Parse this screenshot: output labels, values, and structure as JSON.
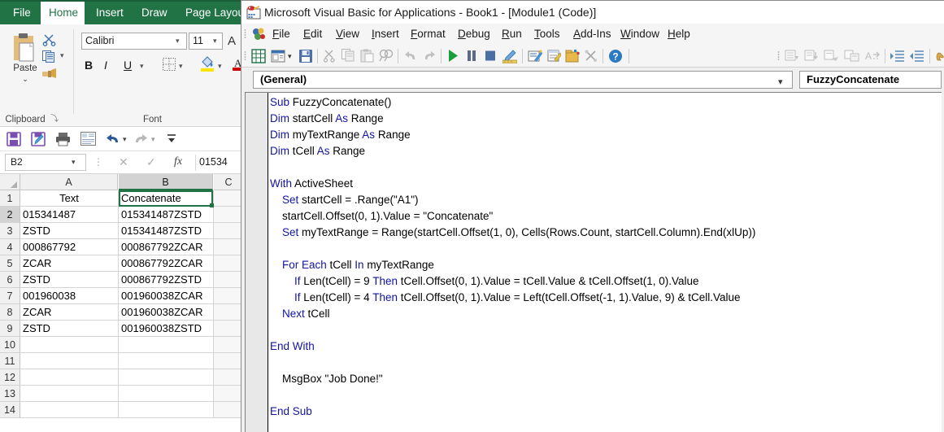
{
  "excel": {
    "ribbon_tabs": [
      {
        "label": "File",
        "active": false
      },
      {
        "label": "Home",
        "active": true
      },
      {
        "label": "Insert",
        "active": false
      },
      {
        "label": "Draw",
        "active": false
      },
      {
        "label": "Page Layout",
        "active": false
      }
    ],
    "groups": {
      "clipboard": {
        "label": "Clipboard",
        "paste_label": "Paste",
        "paste_caret": "⌄",
        "cut_icon": "scissors-icon",
        "copy_icon": "copy-icon",
        "format_painter_icon": "paintbrush-icon",
        "dialog_launcher": "⤵"
      },
      "font": {
        "label": "Font",
        "font_name": "Calibri",
        "font_size": "11",
        "bold_label": "B",
        "italic_label": "I",
        "underline_label": "U",
        "grow_font_label": "A",
        "borders_icon": "borders-icon",
        "fill_color_icon": "fill-color-icon",
        "font_color_icon": "font-color-icon"
      }
    },
    "quick_access": [
      {
        "icon": "save-icon",
        "name": "save"
      },
      {
        "icon": "save-as-icon",
        "name": "save-as"
      },
      {
        "icon": "print-icon",
        "name": "print"
      },
      {
        "icon": "print-preview-icon",
        "name": "print-preview"
      },
      {
        "icon": "undo-icon",
        "name": "undo"
      },
      {
        "icon": "redo-icon",
        "name": "redo"
      },
      {
        "icon": "customize-icon",
        "name": "customize"
      }
    ],
    "formula_bar": {
      "name_box": "B2",
      "cancel_label": "✕",
      "enter_label": "✓",
      "fx_label": "fx",
      "value": "01534"
    },
    "grid": {
      "columns": [
        {
          "label": "A",
          "selected": false
        },
        {
          "label": "B",
          "selected": true
        },
        {
          "label": "C",
          "selected": false
        }
      ],
      "selected_cell": "B2",
      "rows": [
        {
          "num": "1",
          "a": "Text",
          "b": "Concatenate",
          "a_center": true
        },
        {
          "num": "2",
          "a": "015341487",
          "b": "015341487ZSTD",
          "a_center": false
        },
        {
          "num": "3",
          "a": "ZSTD",
          "b": "015341487ZSTD",
          "a_center": false
        },
        {
          "num": "4",
          "a": "000867792",
          "b": "000867792ZCAR",
          "a_center": false
        },
        {
          "num": "5",
          "a": "ZCAR",
          "b": "000867792ZCAR",
          "a_center": false
        },
        {
          "num": "6",
          "a": "ZSTD",
          "b": "000867792ZSTD",
          "a_center": false
        },
        {
          "num": "7",
          "a": "001960038",
          "b": "001960038ZCAR",
          "a_center": false
        },
        {
          "num": "8",
          "a": "ZCAR",
          "b": "001960038ZCAR",
          "a_center": false
        },
        {
          "num": "9",
          "a": "ZSTD",
          "b": "001960038ZSTD",
          "a_center": false
        },
        {
          "num": "10",
          "a": "",
          "b": "",
          "a_center": false
        },
        {
          "num": "11",
          "a": "",
          "b": "",
          "a_center": false
        },
        {
          "num": "12",
          "a": "",
          "b": "",
          "a_center": false
        },
        {
          "num": "13",
          "a": "",
          "b": "",
          "a_center": false
        },
        {
          "num": "14",
          "a": "",
          "b": "",
          "a_center": false
        }
      ]
    }
  },
  "vba": {
    "title": "Microsoft Visual Basic for Applications - Book1 - [Module1 (Code)]",
    "menu": [
      {
        "label": "File"
      },
      {
        "label": "Edit"
      },
      {
        "label": "View"
      },
      {
        "label": "Insert"
      },
      {
        "label": "Format"
      },
      {
        "label": "Debug"
      },
      {
        "label": "Run"
      },
      {
        "label": "Tools"
      },
      {
        "label": "Add-Ins"
      },
      {
        "label": "Window"
      },
      {
        "label": "Help"
      }
    ],
    "toolbar": [
      {
        "name": "view-excel-icon"
      },
      {
        "name": "insert-userform-icon"
      },
      {
        "name": "save-icon"
      },
      {
        "name": "cut-icon"
      },
      {
        "name": "copy-icon"
      },
      {
        "name": "paste-icon"
      },
      {
        "name": "find-icon"
      },
      {
        "name": "undo-icon"
      },
      {
        "name": "redo-icon"
      },
      {
        "name": "run-icon"
      },
      {
        "name": "break-icon"
      },
      {
        "name": "reset-icon"
      },
      {
        "name": "design-mode-icon"
      },
      {
        "name": "project-explorer-icon"
      },
      {
        "name": "properties-window-icon"
      },
      {
        "name": "object-browser-icon"
      },
      {
        "name": "toolbox-icon"
      },
      {
        "name": "help-icon"
      }
    ],
    "toolbar2": [
      {
        "name": "list-properties-icon"
      },
      {
        "name": "list-constants-icon"
      },
      {
        "name": "quick-info-icon"
      },
      {
        "name": "parameter-info-icon"
      },
      {
        "name": "complete-word-icon"
      },
      {
        "name": "indent-icon"
      },
      {
        "name": "outdent-icon"
      },
      {
        "name": "toggle-breakpoint-icon"
      }
    ],
    "object_combo": "(General)",
    "proc_combo": "FuzzyConcatenate",
    "code": [
      [
        {
          "t": "Sub ",
          "k": true
        },
        {
          "t": "FuzzyConcatenate()",
          "k": false
        }
      ],
      [
        {
          "t": "Dim ",
          "k": true
        },
        {
          "t": "startCell ",
          "k": false
        },
        {
          "t": "As ",
          "k": true
        },
        {
          "t": "Range",
          "k": false
        }
      ],
      [
        {
          "t": "Dim ",
          "k": true
        },
        {
          "t": "myTextRange ",
          "k": false
        },
        {
          "t": "As ",
          "k": true
        },
        {
          "t": "Range",
          "k": false
        }
      ],
      [
        {
          "t": "Dim ",
          "k": true
        },
        {
          "t": "tCell ",
          "k": false
        },
        {
          "t": "As ",
          "k": true
        },
        {
          "t": "Range",
          "k": false
        }
      ],
      [],
      [
        {
          "t": "With ",
          "k": true
        },
        {
          "t": "ActiveSheet",
          "k": false
        }
      ],
      [
        {
          "t": "    Set ",
          "k": true
        },
        {
          "t": "startCell = .Range(\"A1\")",
          "k": false
        }
      ],
      [
        {
          "t": "    startCell.Offset(0, 1).Value = \"Concatenate\"",
          "k": false
        }
      ],
      [
        {
          "t": "    Set ",
          "k": true
        },
        {
          "t": "myTextRange = Range(startCell.Offset(1, 0), Cells(Rows.Count, startCell.Column).End(xlUp))",
          "k": false
        }
      ],
      [],
      [
        {
          "t": "    For Each ",
          "k": true
        },
        {
          "t": "tCell ",
          "k": false
        },
        {
          "t": "In ",
          "k": true
        },
        {
          "t": "myTextRange",
          "k": false
        }
      ],
      [
        {
          "t": "        If ",
          "k": true
        },
        {
          "t": "Len(tCell) = 9 ",
          "k": false
        },
        {
          "t": "Then ",
          "k": true
        },
        {
          "t": "tCell.Offset(0, 1).Value = tCell.Value & tCell.Offset(1, 0).Value",
          "k": false
        }
      ],
      [
        {
          "t": "        If ",
          "k": true
        },
        {
          "t": "Len(tCell) = 4 ",
          "k": false
        },
        {
          "t": "Then ",
          "k": true
        },
        {
          "t": "tCell.Offset(0, 1).Value = Left(tCell.Offset(-1, 1).Value, 9) & tCell.Value",
          "k": false
        }
      ],
      [
        {
          "t": "    Next ",
          "k": true
        },
        {
          "t": "tCell",
          "k": false
        }
      ],
      [],
      [
        {
          "t": "End With",
          "k": true
        }
      ],
      [],
      [
        {
          "t": "    MsgBox \"Job Done!\"",
          "k": false
        }
      ],
      [],
      [
        {
          "t": "End Sub",
          "k": true
        }
      ]
    ]
  },
  "colors": {
    "excel_green": "#217346",
    "vba_keyword_blue": "#1414a0",
    "selection_green": "#217346"
  }
}
